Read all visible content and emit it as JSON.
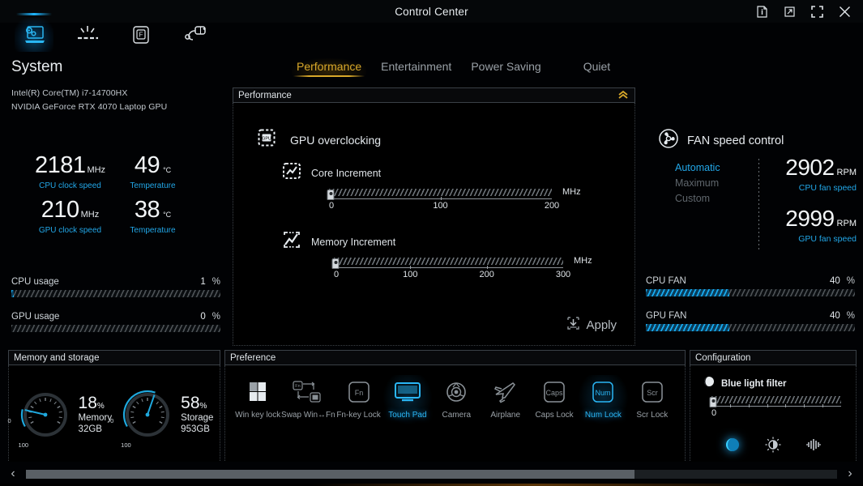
{
  "window": {
    "title": "Control Center",
    "buttons": [
      {
        "name": "info-icon",
        "label": "Info"
      },
      {
        "name": "minimize-icon",
        "label": "Minimize"
      },
      {
        "name": "maximize-icon",
        "label": "Maximize"
      },
      {
        "name": "close-icon",
        "label": "Close"
      }
    ]
  },
  "nav": {
    "items": [
      {
        "name": "nav-system",
        "label": "System",
        "active": true
      },
      {
        "name": "nav-keyboard-backlight",
        "label": "Keyboard Backlight",
        "active": false
      },
      {
        "name": "nav-fn-key",
        "label": "Fn Key",
        "active": false
      },
      {
        "name": "nav-device",
        "label": "Device",
        "active": false
      }
    ]
  },
  "system": {
    "title": "System",
    "cpu_model": "Intel(R) Core(TM) i7-14700HX",
    "gpu_model": "NVIDIA GeForce RTX 4070 Laptop GPU"
  },
  "profiles": {
    "tabs": [
      {
        "label": "Performance",
        "active": true
      },
      {
        "label": "Entertainment",
        "active": false
      },
      {
        "label": "Power Saving",
        "active": false
      },
      {
        "label": "Quiet",
        "active": false
      }
    ],
    "accent": "#d8a82a"
  },
  "readouts": {
    "cpu_clock": {
      "value": "2181",
      "unit": "MHz",
      "label": "CPU clock speed"
    },
    "cpu_temp": {
      "value": "49",
      "unit": "°C",
      "label": "Temperature"
    },
    "gpu_clock": {
      "value": "210",
      "unit": "MHz",
      "label": "GPU clock speed"
    },
    "gpu_temp": {
      "value": "38",
      "unit": "°C",
      "label": "Temperature"
    }
  },
  "usage": {
    "cpu": {
      "label": "CPU usage",
      "value": "1",
      "unit": "%",
      "percent": 1
    },
    "gpu": {
      "label": "GPU usage",
      "value": "0",
      "unit": "%",
      "percent": 0
    }
  },
  "performance_panel": {
    "title": "Performance",
    "collapse_icon": "«",
    "gpu_overclocking_label": "GPU overclocking",
    "core_increment": {
      "label": "Core Increment",
      "unit": "MHz",
      "value": 0,
      "min": 0,
      "max": 200,
      "ticks": [
        "0",
        "100",
        "200"
      ]
    },
    "memory_increment": {
      "label": "Memory Increment",
      "unit": "MHz",
      "value": 0,
      "min": 0,
      "max": 300,
      "ticks": [
        "0",
        "100",
        "200",
        "300"
      ]
    },
    "apply_label": "Apply"
  },
  "fan": {
    "title": "FAN speed control",
    "modes": [
      {
        "label": "Automatic",
        "active": true
      },
      {
        "label": "Maximum",
        "active": false
      },
      {
        "label": "Custom",
        "active": false
      }
    ],
    "cpu_fan_speed": {
      "value": "2902",
      "unit": "RPM",
      "label": "CPU fan speed"
    },
    "gpu_fan_speed": {
      "value": "2999",
      "unit": "RPM",
      "label": "GPU fan speed"
    },
    "cpu_fan_bar": {
      "label": "CPU FAN",
      "value": "40",
      "unit": "%",
      "percent": 40
    },
    "gpu_fan_bar": {
      "label": "GPU FAN",
      "value": "40",
      "unit": "%",
      "percent": 40
    }
  },
  "memory_storage": {
    "title": "Memory and storage",
    "gauges": [
      {
        "percent_text": "18",
        "percent_symbol": "%",
        "name": "Memory",
        "capacity": "32GB",
        "percent": 18,
        "min_label": "0",
        "max_label": "100"
      },
      {
        "percent_text": "58",
        "percent_symbol": "%",
        "name": "Storage",
        "capacity": "953GB",
        "percent": 58,
        "min_label": "0",
        "max_label": "100"
      }
    ]
  },
  "preference": {
    "title": "Preference",
    "items": [
      {
        "caption": "Win key lock",
        "icon": "win-key-lock-icon",
        "on": false
      },
      {
        "caption": "Swap Win↔Fn",
        "icon": "swap-win-fn-icon",
        "on": false
      },
      {
        "caption": "Fn-key Lock",
        "icon": "fn-key-lock-icon",
        "on": false
      },
      {
        "caption": "Touch Pad",
        "icon": "touchpad-icon",
        "on": true
      },
      {
        "caption": "Camera",
        "icon": "camera-icon",
        "on": false
      },
      {
        "caption": "Airplane",
        "icon": "airplane-icon",
        "on": false
      },
      {
        "caption": "Caps Lock",
        "icon": "caps-lock-icon",
        "on": false
      },
      {
        "caption": "Num Lock",
        "icon": "num-lock-icon",
        "on": true
      },
      {
        "caption": "Scr Lock",
        "icon": "scr-lock-icon",
        "on": false
      }
    ],
    "key_glyphs": {
      "fn": "Fn",
      "caps": "Caps",
      "num": "Num",
      "scr": "Scr"
    }
  },
  "configuration": {
    "title": "Configuration",
    "blue_light_filter": {
      "label": "Blue light filter",
      "value": 0,
      "value_label": "0",
      "min": 0,
      "max": 100
    },
    "modes": [
      {
        "name": "blue-light-mode-icon",
        "on": true
      },
      {
        "name": "brightness-mode-icon",
        "on": false
      },
      {
        "name": "contrast-mode-icon",
        "on": false
      }
    ]
  },
  "scrollbar": {
    "left_arrow": "‹",
    "right_arrow": "›",
    "thumb_percent": 75
  },
  "colors": {
    "accent_blue": "#22a7e8",
    "accent_gold": "#d8a82a",
    "background": "#000000"
  }
}
